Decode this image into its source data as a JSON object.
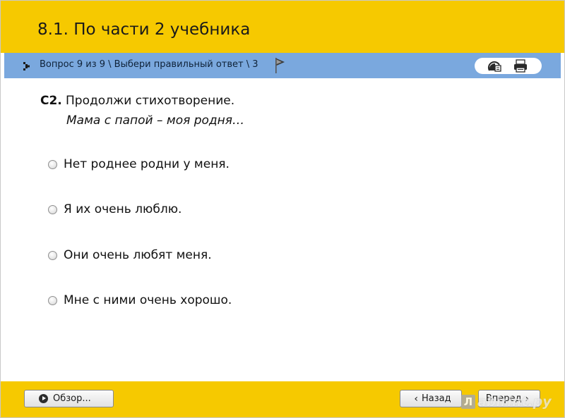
{
  "header": {
    "title": "8.1. По части 2 учебника"
  },
  "navbar": {
    "breadcrumb": "Вопрос 9 из 9 \\ Выбери правильный ответ \\ 3"
  },
  "question": {
    "label": "С2.",
    "text": "Продолжи стихотворение.",
    "subtext": "Мама с папой – моя родня…"
  },
  "options": [
    {
      "text": "Нет роднее родни у меня."
    },
    {
      "text": "Я их очень люблю."
    },
    {
      "text": "Они очень любят меня."
    },
    {
      "text": "Мне с ними очень хорошо."
    }
  ],
  "footer": {
    "review_label": "Обзор...",
    "back_label": "Назад",
    "next_label": "Вперед",
    "watermark_logo": "Л",
    "watermark_text": "abirint.ру"
  },
  "colors": {
    "header_bg": "#f6c900",
    "navbar_bg": "#7aa8de"
  }
}
